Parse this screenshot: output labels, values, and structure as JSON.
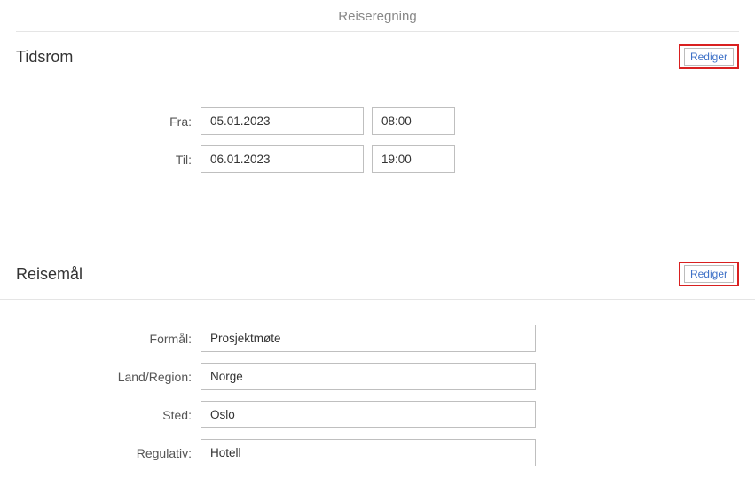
{
  "page": {
    "title": "Reiseregning"
  },
  "tidsrom": {
    "title": "Tidsrom",
    "edit_label": "Rediger",
    "fra_label": "Fra:",
    "fra_date": "05.01.2023",
    "fra_time": "08:00",
    "til_label": "Til:",
    "til_date": "06.01.2023",
    "til_time": "19:00"
  },
  "reisemal": {
    "title": "Reisemål",
    "edit_label": "Rediger",
    "formal_label": "Formål:",
    "formal_value": "Prosjektmøte",
    "land_label": "Land/Region:",
    "land_value": "Norge",
    "sted_label": "Sted:",
    "sted_value": "Oslo",
    "regulativ_label": "Regulativ:",
    "regulativ_value": "Hotell"
  }
}
